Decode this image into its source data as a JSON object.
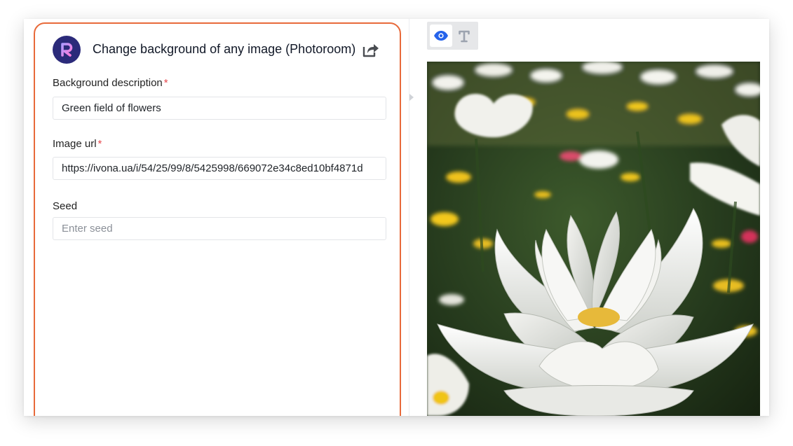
{
  "panel": {
    "title": "Change background of any image (Photoroom)",
    "logo_icon": "photoroom-logo-icon",
    "share_icon": "share-icon",
    "accent_color": "#e86a3a"
  },
  "form": {
    "background_description": {
      "label": "Background description",
      "required_mark": "*",
      "value": "Green field of flowers"
    },
    "image_url": {
      "label": "Image url",
      "required_mark": "*",
      "value": "https://ivona.ua/i/54/25/99/8/5425998/669072e34c8ed10bf4871d"
    },
    "seed": {
      "label": "Seed",
      "value": "",
      "placeholder": "Enter seed"
    }
  },
  "view_toggle": {
    "selected": "preview",
    "options": [
      "eye-icon",
      "text-icon"
    ]
  },
  "preview": {
    "image": "white lotus flower in a field of flowers"
  }
}
